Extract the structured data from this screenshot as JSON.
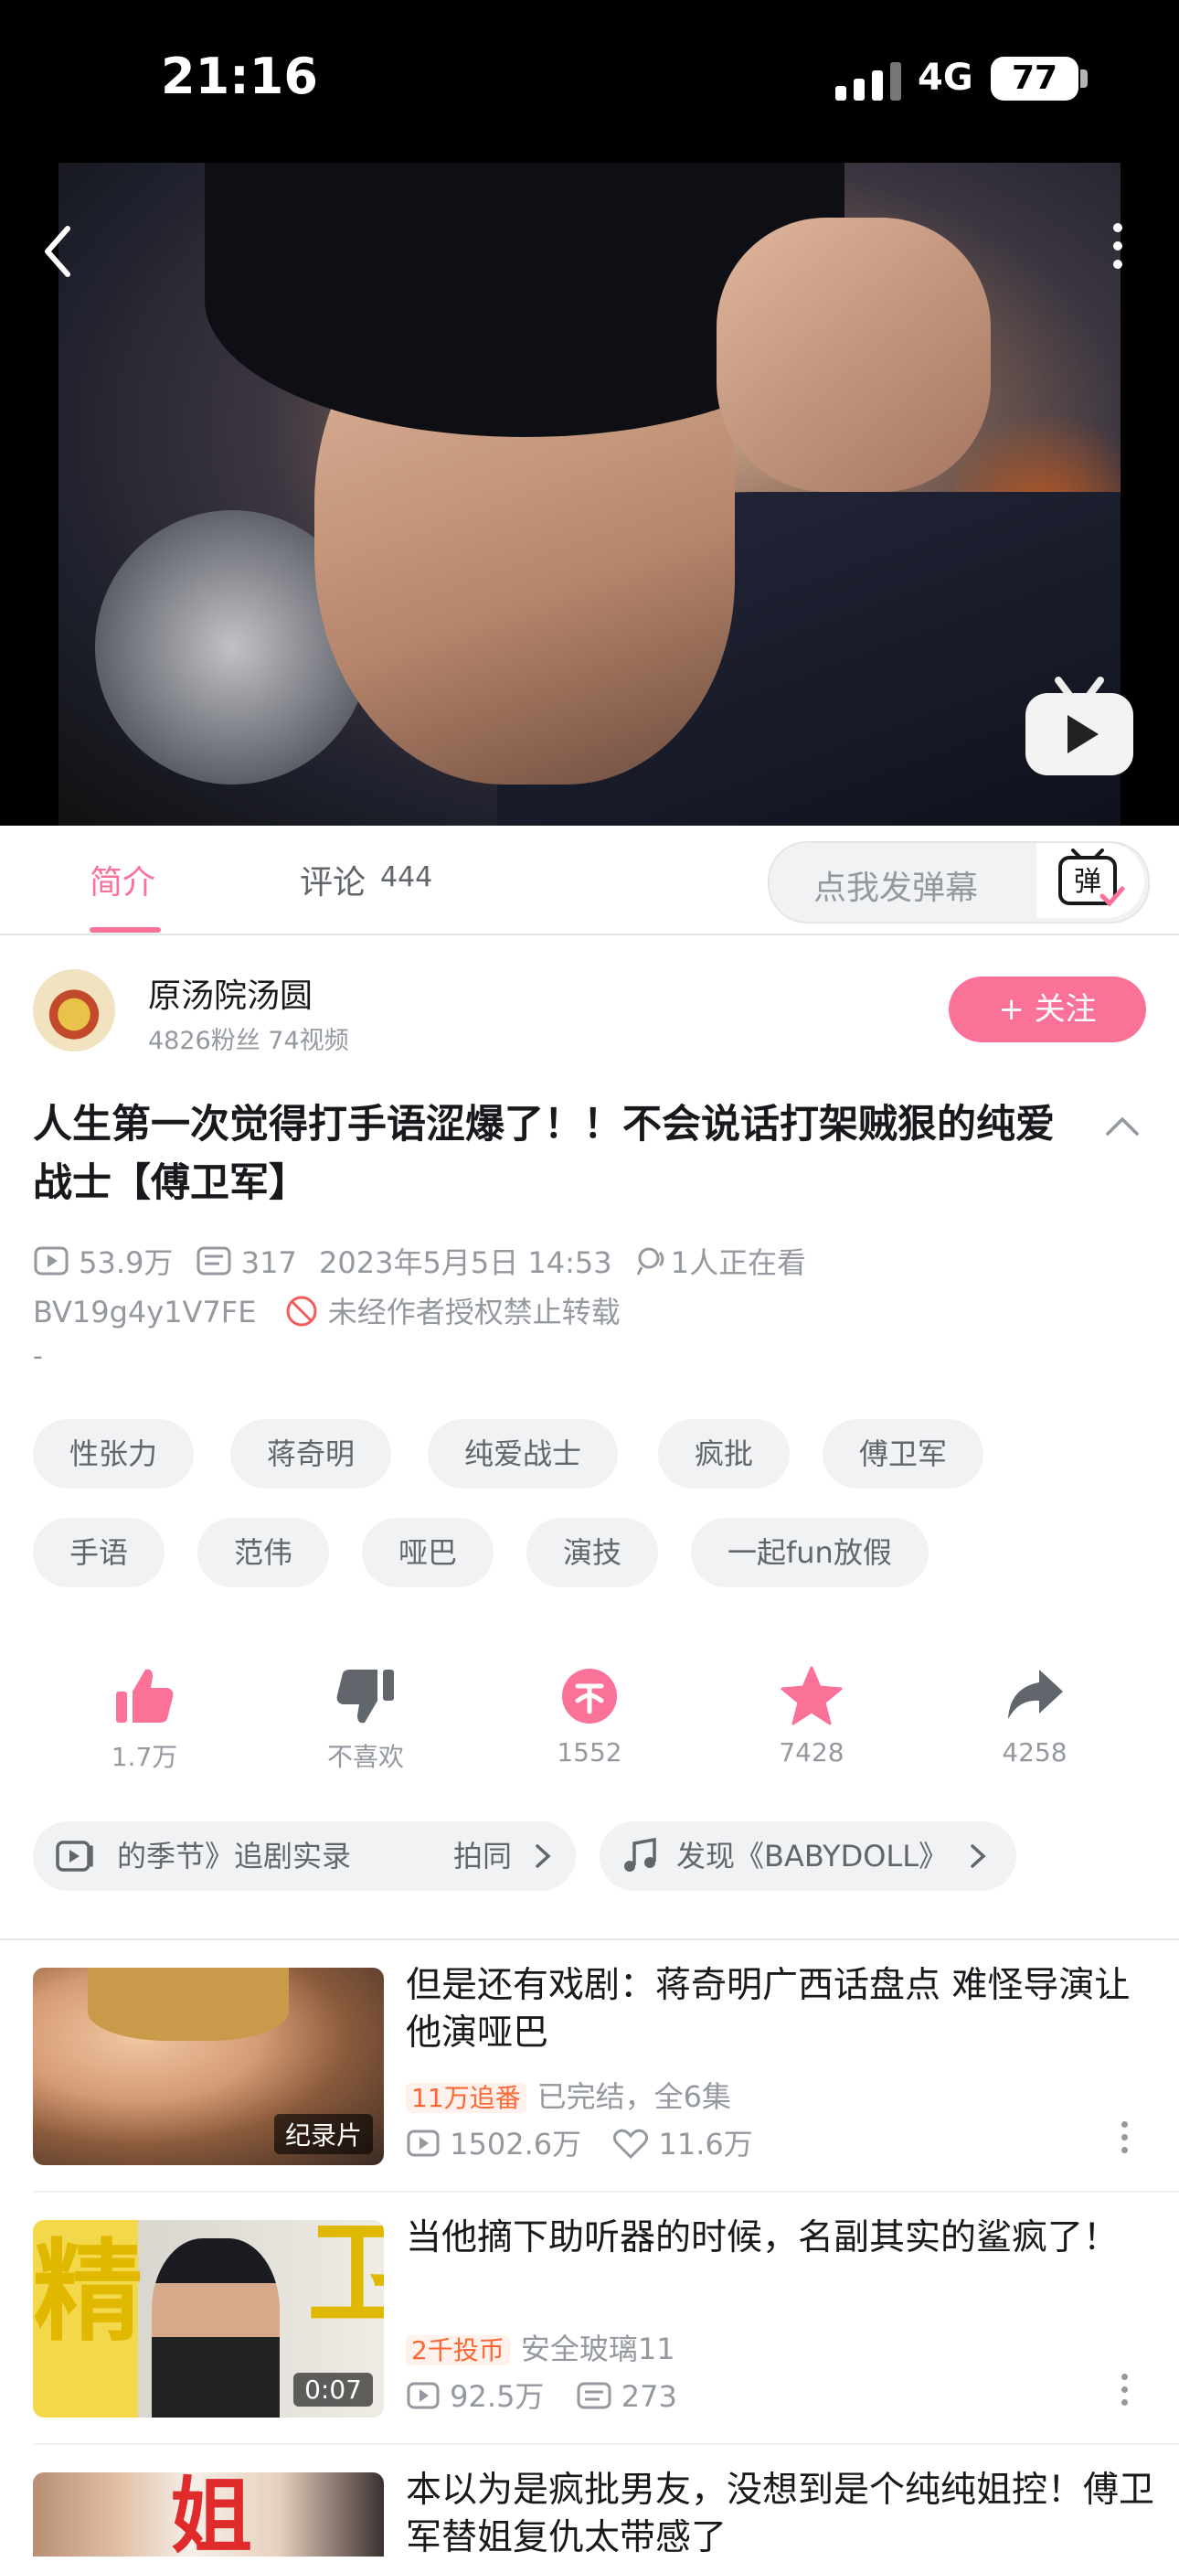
{
  "status": {
    "time": "21:16",
    "network": "4G",
    "battery": "77"
  },
  "tabs": {
    "intro": "简介",
    "comments": "评论",
    "comments_count": "444"
  },
  "danmaku": {
    "placeholder": "点我发弹幕",
    "button_label": "弹"
  },
  "uploader": {
    "name": "原汤院汤圆",
    "stats": "4826粉丝  74视频",
    "follow_label": "+ 关注"
  },
  "video": {
    "title": "人生第一次觉得打手语涩爆了！！不会说话打架贼狠的纯爱战士【傅卫军】",
    "views": "53.9万",
    "danmaku_count": "317",
    "date": "2023年5月5日 14:53",
    "watching": "1人正在看",
    "bvid": "BV19g4y1V7FE",
    "copyright": "未经作者授权禁止转载",
    "desc": "-"
  },
  "tags": [
    "性张力",
    "蒋奇明",
    "纯爱战士",
    "疯批",
    "傅卫军",
    "手语",
    "范伟",
    "哑巴",
    "演技",
    "一起fun放假"
  ],
  "actions": {
    "like": "1.7万",
    "dislike": "不喜欢",
    "coin": "1552",
    "favorite": "7428",
    "share": "4258"
  },
  "pills": {
    "left_text": "的季节》追剧实录",
    "left_suffix": "拍同",
    "right_text": "发现《BABYDOLL》"
  },
  "recommendations": [
    {
      "title": "但是还有戏剧：蒋奇明广西话盘点 难怪导演让他演哑巴",
      "badge": "纪录片",
      "highlight": "11万追番",
      "info": "已完结，全6集",
      "views": "1502.6万",
      "second_stat": "11.6万"
    },
    {
      "title": "当他摘下助听器的时候，名副其实的鲨疯了！",
      "badge": "0:07",
      "highlight": "2千投币",
      "info": "安全玻璃11",
      "views": "92.5万",
      "second_stat": "273"
    },
    {
      "title": "本以为是疯批男友，没想到是个纯纯姐控！傅卫军替姐复仇太带感了"
    }
  ],
  "colors": {
    "accent": "#fb7299",
    "text": "#18191c",
    "muted": "#9499a0"
  }
}
